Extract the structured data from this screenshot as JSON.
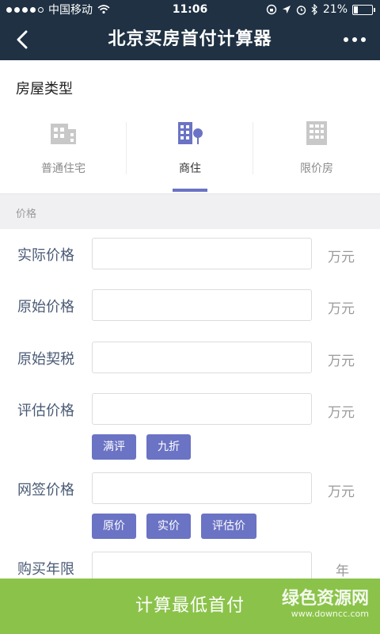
{
  "status_bar": {
    "carrier": "中国移动",
    "time": "11:06",
    "battery": "21%",
    "battery_level": 0.21
  },
  "header": {
    "title": "北京买房首付计算器"
  },
  "house_type": {
    "title": "房屋类型",
    "tabs": [
      {
        "label": "普通住宅",
        "active": false
      },
      {
        "label": "商住",
        "active": true
      },
      {
        "label": "限价房",
        "active": false
      }
    ]
  },
  "price_section": {
    "header": "价格"
  },
  "fields": {
    "actual_price": {
      "label": "实际价格",
      "value": "",
      "unit": "万元"
    },
    "original_price": {
      "label": "原始价格",
      "value": "",
      "unit": "万元"
    },
    "original_tax": {
      "label": "原始契税",
      "value": "",
      "unit": "万元"
    },
    "assessed_price": {
      "label": "评估价格",
      "value": "",
      "unit": "万元"
    },
    "contract_price": {
      "label": "网签价格",
      "value": "",
      "unit": "万元"
    },
    "years": {
      "label": "购买年限",
      "value": "",
      "unit": "年"
    }
  },
  "assessed_chips": [
    "满评",
    "九折"
  ],
  "contract_chips": [
    "原价",
    "实价",
    "评估价"
  ],
  "footer": {
    "calc_button": "计算最低首付",
    "watermark_name": "绿色资源网",
    "watermark_url": "www.downcc.com"
  },
  "colors": {
    "nav_bg": "#1f3143",
    "accent": "#6b73c4",
    "footer_bg": "#8bc34a",
    "label": "#4a5a74"
  }
}
